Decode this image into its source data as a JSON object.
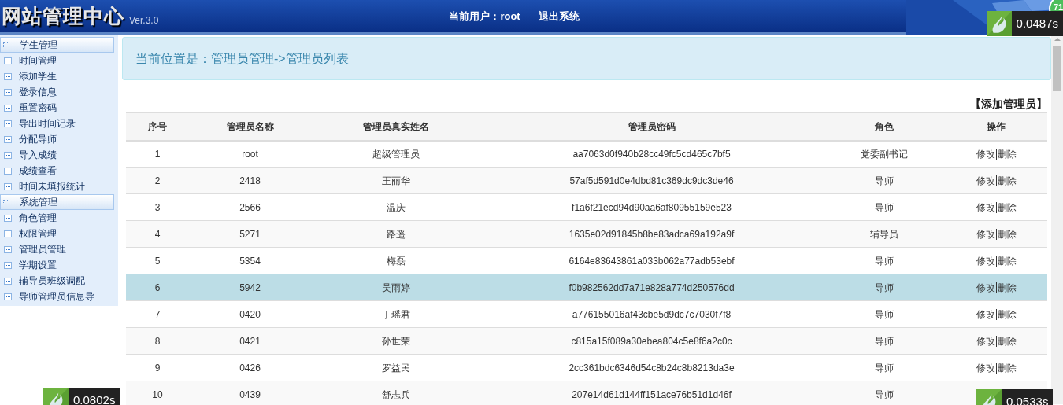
{
  "header": {
    "title": "网站管理中心",
    "version": "Ver.3.0",
    "user_label": "当前用户：root",
    "logout": "退出系统",
    "badge_count": "71"
  },
  "sidebar": {
    "items": [
      {
        "kind": "group",
        "label": "学生管理"
      },
      {
        "kind": "item",
        "label": "时间管理"
      },
      {
        "kind": "item",
        "label": "添加学生"
      },
      {
        "kind": "item",
        "label": "登录信息"
      },
      {
        "kind": "item",
        "label": "重置密码"
      },
      {
        "kind": "item",
        "label": "导出时间记录"
      },
      {
        "kind": "item",
        "label": "分配导师"
      },
      {
        "kind": "item",
        "label": "导入成绩"
      },
      {
        "kind": "item",
        "label": "成绩查看"
      },
      {
        "kind": "item",
        "label": "时间未填报统计"
      },
      {
        "kind": "group",
        "label": "系统管理"
      },
      {
        "kind": "item",
        "label": "角色管理"
      },
      {
        "kind": "item",
        "label": "权限管理"
      },
      {
        "kind": "item",
        "label": "管理员管理"
      },
      {
        "kind": "item",
        "label": "学期设置"
      },
      {
        "kind": "item",
        "label": "辅导员班级调配"
      },
      {
        "kind": "item",
        "label": "导师管理员信息导"
      }
    ]
  },
  "breadcrumb": "当前位置是：管理员管理->管理员列表",
  "add_link": "【添加管理员】",
  "table": {
    "columns": [
      "序号",
      "管理员名称",
      "管理员真实姓名",
      "管理员密码",
      "角色",
      "操作"
    ],
    "rows": [
      {
        "cells": [
          "1",
          "root",
          "超级管理员",
          "aa7063d0f940b28cc49fc5cd465c7bf5",
          "党委副书记"
        ],
        "edit": "修改",
        "delete": "删除",
        "selected": false
      },
      {
        "cells": [
          "2",
          "2418",
          "王丽华",
          "57af5d591d0e4dbd81c369dc9dc3de46",
          "导师"
        ],
        "edit": "修改",
        "delete": "删除",
        "selected": false
      },
      {
        "cells": [
          "3",
          "2566",
          "温庆",
          "f1a6f21ecd94d90aa6af80955159e523",
          "导师"
        ],
        "edit": "修改",
        "delete": "删除",
        "selected": false
      },
      {
        "cells": [
          "4",
          "5271",
          "路遥",
          "1635e02d91845b8be83adca69a192a9f",
          "辅导员"
        ],
        "edit": "修改",
        "delete": "删除",
        "selected": false
      },
      {
        "cells": [
          "5",
          "5354",
          "梅磊",
          "6164e83643861a033b062a77adb53ebf",
          "导师"
        ],
        "edit": "修改",
        "delete": "删除",
        "selected": false
      },
      {
        "cells": [
          "6",
          "5942",
          "吴雨婷",
          "f0b982562dd7a71e828a774d250576dd",
          "导师"
        ],
        "edit": "修改",
        "delete": "删除",
        "selected": true
      },
      {
        "cells": [
          "7",
          "0420",
          "丁瑶君",
          "a776155016af43cbe5d9dc7c7030f7f8",
          "导师"
        ],
        "edit": "修改",
        "delete": "删除",
        "selected": false
      },
      {
        "cells": [
          "8",
          "0421",
          "孙世荣",
          "c815a15f089a30ebea804c5e8f6a2c0c",
          "导师"
        ],
        "edit": "修改",
        "delete": "删除",
        "selected": false
      },
      {
        "cells": [
          "9",
          "0426",
          "罗益民",
          "2cc361bdc6346d54c8b24c8b8213da3e",
          "导师"
        ],
        "edit": "修改",
        "delete": "删除",
        "selected": false
      },
      {
        "cells": [
          "10",
          "0439",
          "舒志兵",
          "207e14d61d144ff151ace76b51d1d46f",
          "导师"
        ],
        "selected": false
      }
    ]
  },
  "timers": [
    {
      "kind": "top-right",
      "text": "0.0487s"
    },
    {
      "kind": "bottom-left",
      "text": "0.0802s"
    },
    {
      "kind": "bottom-right",
      "text": "0.0533s"
    }
  ]
}
